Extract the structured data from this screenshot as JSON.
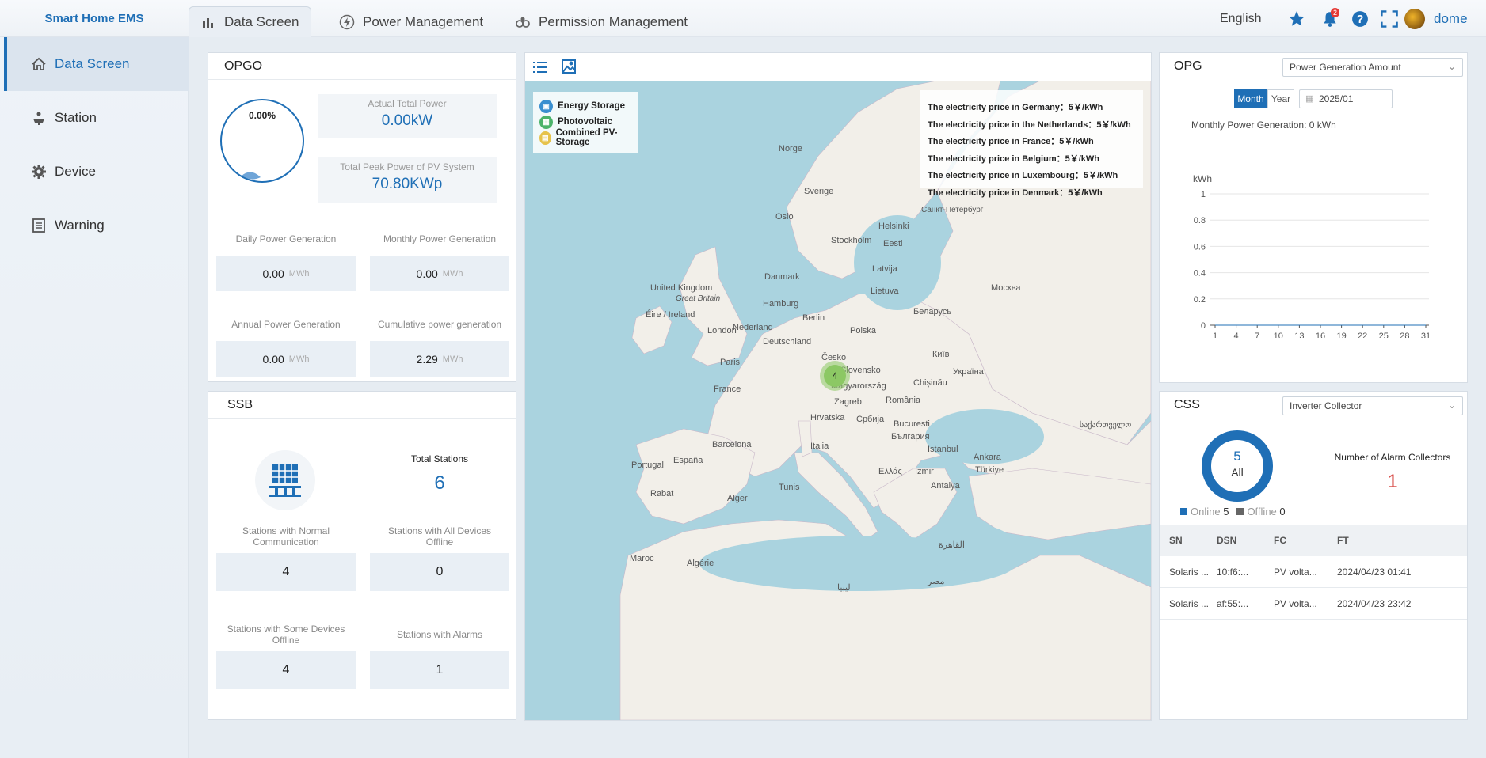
{
  "app": {
    "title": "Smart Home EMS"
  },
  "nav": {
    "tabs": [
      {
        "label": "Data Screen",
        "icon": "bar-chart-icon",
        "active": true
      },
      {
        "label": "Power Management",
        "icon": "lightning-icon"
      },
      {
        "label": "Permission Management",
        "icon": "users-icon"
      }
    ]
  },
  "header": {
    "language": "English",
    "notification_count": "2",
    "username": "dome"
  },
  "sidebar": {
    "items": [
      {
        "label": "Data Screen",
        "icon": "home-icon",
        "active": true
      },
      {
        "label": "Station",
        "icon": "solar-panel-icon"
      },
      {
        "label": "Device",
        "icon": "gear-icon"
      },
      {
        "label": "Warning",
        "icon": "document-icon"
      }
    ]
  },
  "opgo": {
    "title": "OPGO",
    "gauge_percent": "0.00%",
    "gauge_fraction": 0.0,
    "actual_power_label": "Actual Total Power",
    "actual_power_value": "0.00kW",
    "peak_power_label": "Total Peak Power of PV System",
    "peak_power_value": "70.80KWp",
    "cards": [
      {
        "label": "Daily Power Generation",
        "value": "0.00",
        "unit": "MWh"
      },
      {
        "label": "Monthly Power Generation",
        "value": "0.00",
        "unit": "MWh"
      },
      {
        "label": "Annual Power Generation",
        "value": "0.00",
        "unit": "MWh"
      },
      {
        "label": "Cumulative power generation",
        "value": "2.29",
        "unit": "MWh"
      }
    ]
  },
  "ssb": {
    "title": "SSB",
    "total_label": "Total Stations",
    "total_value": "6",
    "cards": [
      {
        "label": "Stations with Normal Communication",
        "value": "4"
      },
      {
        "label": "Stations with All Devices Offline",
        "value": "0"
      },
      {
        "label": "Stations with Some Devices Offline",
        "value": "4"
      },
      {
        "label": "Stations with Alarms",
        "value": "1"
      }
    ]
  },
  "map": {
    "legend": [
      {
        "label": "Energy Storage",
        "color": "#3a8fd0"
      },
      {
        "label": "Photovoltaic",
        "color": "#4cb36a"
      },
      {
        "label": "Combined PV-Storage",
        "color": "#e6c24a"
      }
    ],
    "prices": [
      "The electricity price in Germany：5￥/kWh",
      "The electricity price in the Netherlands：5￥/kWh",
      "The electricity price in France：5￥/kWh",
      "The electricity price in Belgium：5￥/kWh",
      "The electricity price in Luxembourg：5￥/kWh",
      "The electricity price in Denmark：5￥/kWh"
    ],
    "cluster_count": "4",
    "labels": [
      "Norge",
      "Sverige",
      "Oslo",
      "Stockholm",
      "Helsinki",
      "Санкт-Петербург",
      "Eesti",
      "Latvija",
      "Lietuva",
      "Москва",
      "Danmark",
      "Hamburg",
      "Berlin",
      "Nederland",
      "Deutschland",
      "Polska",
      "Беларусь",
      "United Kingdom",
      "Great Britain",
      "Éire / Ireland",
      "London",
      "Paris",
      "France",
      "Česko",
      "Київ",
      "Україна",
      "Slovensko",
      "Magyarország",
      "Chișinău",
      "Zagreb",
      "România",
      "Hrvatska",
      "Србија",
      "Bucuresti",
      "България",
      "Italia",
      "España",
      "Barcelona",
      "Portugal",
      "Istanbul",
      "Türkiye",
      "Ελλάς",
      "Izmir",
      "Antalya",
      "Rabat",
      "Alger",
      "Tunis",
      "Maroc",
      "Algérie",
      "ليبيا",
      "مصر",
      "القاهرة",
      "Ankara",
      "საქართველო"
    ]
  },
  "opg": {
    "title": "OPG",
    "select": "Power Generation Amount",
    "month_btn": "Month",
    "year_btn": "Year",
    "date": "2025/01",
    "monthly_label": "Monthly Power Generation: 0 kWh"
  },
  "chart_data": {
    "type": "line",
    "ylabel": "kWh",
    "x": [
      "1",
      "4",
      "7",
      "10",
      "13",
      "16",
      "19",
      "22",
      "25",
      "28",
      "31"
    ],
    "ylim": [
      0,
      1
    ],
    "yticks": [
      "0",
      "0.2",
      "0.4",
      "0.6",
      "0.8",
      "1"
    ],
    "values": [
      0,
      0,
      0,
      0,
      0,
      0,
      0,
      0,
      0,
      0,
      0
    ],
    "grid": true
  },
  "css": {
    "title": "CSS",
    "select": "Inverter Collector",
    "donut_count": "5",
    "donut_label": "All",
    "online_label": "Online",
    "online_count": "5",
    "offline_label": "Offline",
    "offline_count": "0",
    "online_color": "#1f6fb6",
    "offline_color": "#666666",
    "alarm_label": "Number of Alarm Collectors",
    "alarm_value": "1",
    "table": {
      "headers": [
        "SN",
        "DSN",
        "FC",
        "FT"
      ],
      "rows": [
        [
          "Solaris ...",
          "10:f6:...",
          "PV volta...",
          "2024/04/23 01:41"
        ],
        [
          "Solaris ...",
          "af:55:...",
          "PV volta...",
          "2024/04/23 23:42"
        ]
      ]
    }
  }
}
